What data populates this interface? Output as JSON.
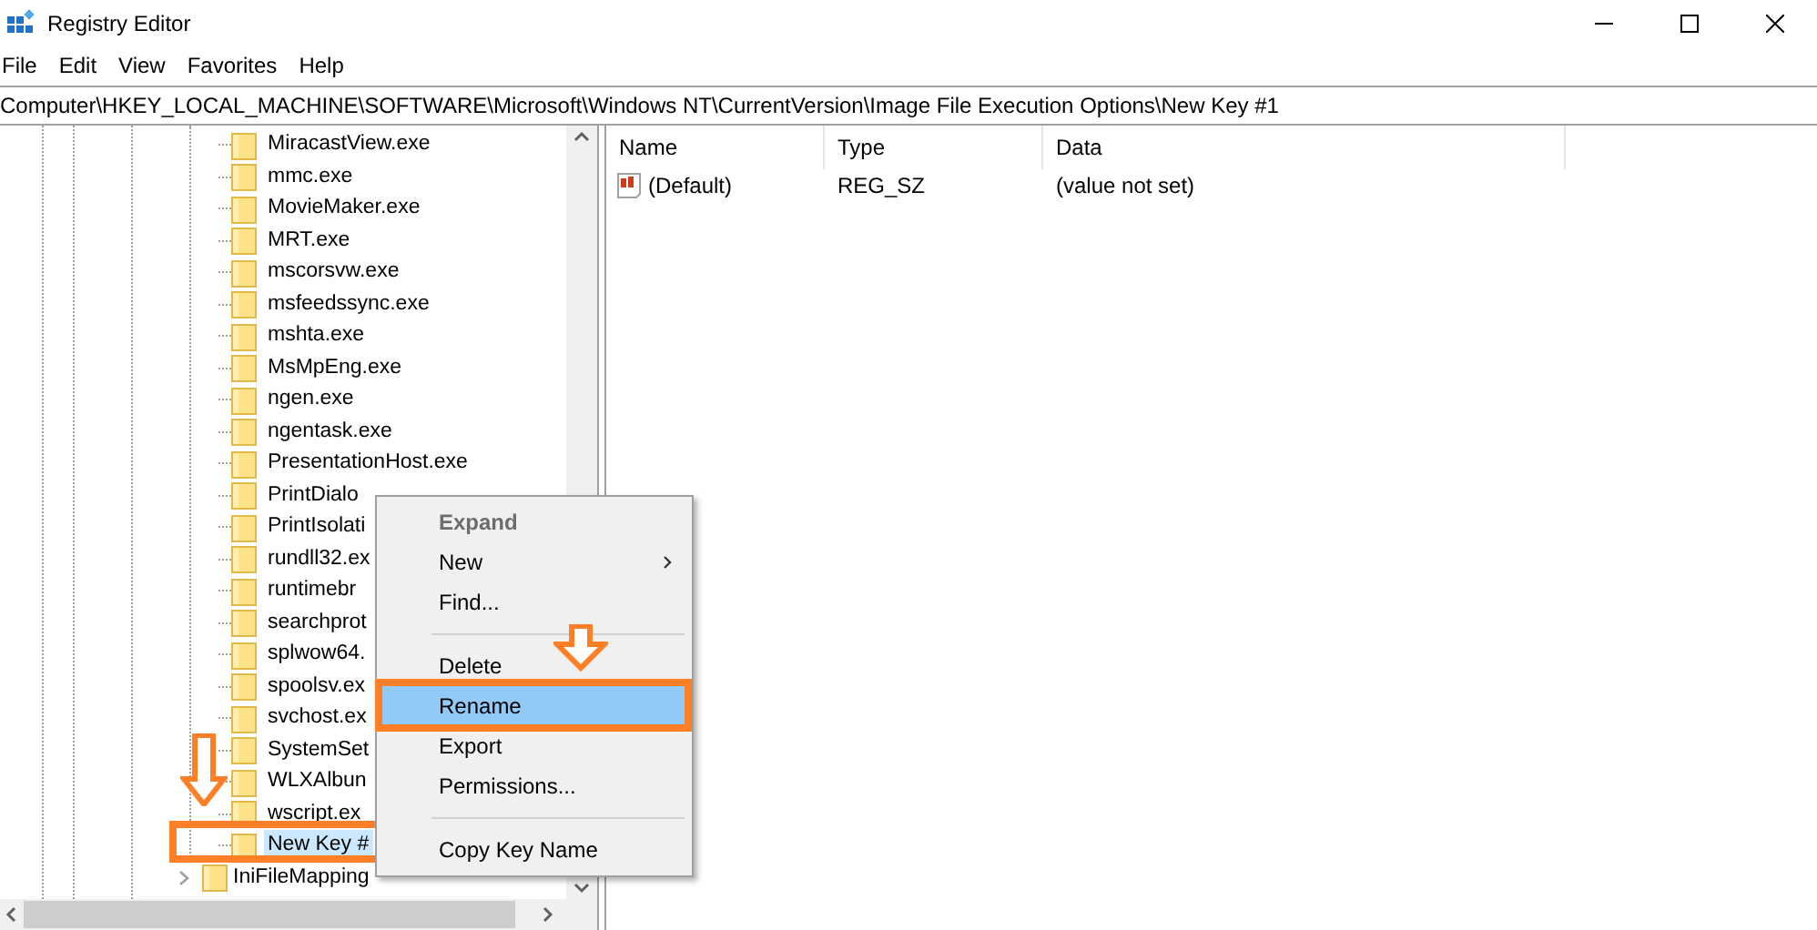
{
  "window": {
    "title": "Registry Editor"
  },
  "menu_bar": [
    "File",
    "Edit",
    "View",
    "Favorites",
    "Help"
  ],
  "address": "Computer\\HKEY_LOCAL_MACHINE\\SOFTWARE\\Microsoft\\Windows NT\\CurrentVersion\\Image File Execution Options\\New Key #1",
  "tree": {
    "items": [
      {
        "label": "MiracastView.exe",
        "selected": false,
        "callout": false
      },
      {
        "label": "mmc.exe",
        "selected": false,
        "callout": false
      },
      {
        "label": "MovieMaker.exe",
        "selected": false,
        "callout": false
      },
      {
        "label": "MRT.exe",
        "selected": false,
        "callout": false
      },
      {
        "label": "mscorsvw.exe",
        "selected": false,
        "callout": false
      },
      {
        "label": "msfeedssync.exe",
        "selected": false,
        "callout": false
      },
      {
        "label": "mshta.exe",
        "selected": false,
        "callout": false
      },
      {
        "label": "MsMpEng.exe",
        "selected": false,
        "callout": false
      },
      {
        "label": "ngen.exe",
        "selected": false,
        "callout": false
      },
      {
        "label": "ngentask.exe",
        "selected": false,
        "callout": false
      },
      {
        "label": "PresentationHost.exe",
        "selected": false,
        "callout": false
      },
      {
        "label": "PrintDialo",
        "selected": false,
        "callout": false
      },
      {
        "label": "PrintIsolati",
        "selected": false,
        "callout": false
      },
      {
        "label": "rundll32.ex",
        "selected": false,
        "callout": false
      },
      {
        "label": "runtimebr",
        "selected": false,
        "callout": false
      },
      {
        "label": "searchprot",
        "selected": false,
        "callout": false
      },
      {
        "label": "splwow64.",
        "selected": false,
        "callout": false
      },
      {
        "label": "spoolsv.ex",
        "selected": false,
        "callout": false
      },
      {
        "label": "svchost.ex",
        "selected": false,
        "callout": false
      },
      {
        "label": "SystemSet",
        "selected": false,
        "callout": false
      },
      {
        "label": "WLXAlbun",
        "selected": false,
        "callout": false
      },
      {
        "label": "wscript.ex",
        "selected": false,
        "callout": false
      },
      {
        "label": "New Key #",
        "selected": true,
        "callout": true
      }
    ],
    "outer_items": [
      {
        "label": "IniFileMapping",
        "expanded": false
      }
    ]
  },
  "values": {
    "columns": [
      "Name",
      "Type",
      "Data"
    ],
    "rows": [
      {
        "name": "(Default)",
        "type": "REG_SZ",
        "data": "(value not set)"
      }
    ]
  },
  "context_menu": [
    {
      "kind": "item",
      "label": "Expand",
      "disabled": true,
      "default": true,
      "submenu": false,
      "selected": false,
      "callout": false
    },
    {
      "kind": "item",
      "label": "New",
      "disabled": false,
      "default": false,
      "submenu": true,
      "selected": false,
      "callout": false
    },
    {
      "kind": "item",
      "label": "Find...",
      "disabled": false,
      "default": false,
      "submenu": false,
      "selected": false,
      "callout": false
    },
    {
      "kind": "separator"
    },
    {
      "kind": "item",
      "label": "Delete",
      "disabled": false,
      "default": false,
      "submenu": false,
      "selected": false,
      "callout": false
    },
    {
      "kind": "item",
      "label": "Rename",
      "disabled": false,
      "default": false,
      "submenu": false,
      "selected": true,
      "callout": true
    },
    {
      "kind": "item",
      "label": "Export",
      "disabled": false,
      "default": false,
      "submenu": false,
      "selected": false,
      "callout": false
    },
    {
      "kind": "item",
      "label": "Permissions...",
      "disabled": false,
      "default": false,
      "submenu": false,
      "selected": false,
      "callout": false
    },
    {
      "kind": "separator"
    },
    {
      "kind": "item",
      "label": "Copy Key Name",
      "disabled": false,
      "default": false,
      "submenu": false,
      "selected": false,
      "callout": false
    }
  ]
}
